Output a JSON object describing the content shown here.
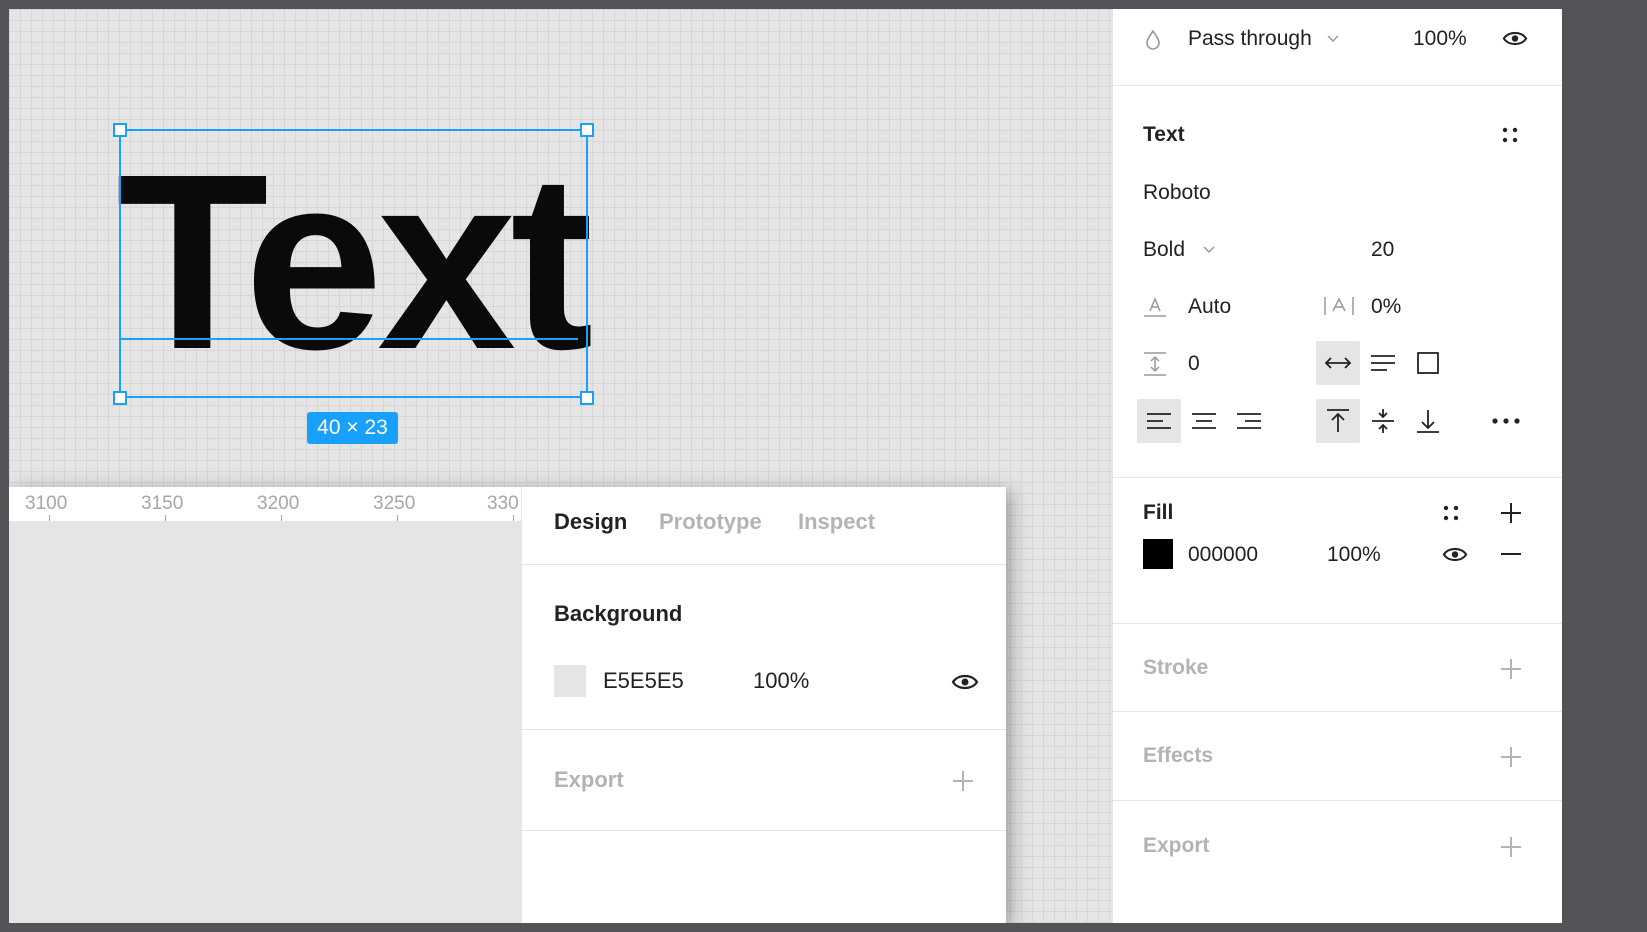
{
  "canvas": {
    "text_layer": "Text",
    "size_badge": "40 × 23"
  },
  "overlay": {
    "ruler": [
      "3100",
      "3150",
      "3200",
      "3250",
      "330"
    ],
    "tabs": [
      {
        "label": "Design",
        "active": true
      },
      {
        "label": "Prototype",
        "active": false
      },
      {
        "label": "Inspect",
        "active": false
      }
    ],
    "background": {
      "title": "Background",
      "color": "E5E5E5",
      "opacity": "100%"
    },
    "export_title": "Export"
  },
  "right_panel": {
    "layer": {
      "blend_mode": "Pass through",
      "opacity": "100%"
    },
    "text": {
      "title": "Text",
      "font_family": "Roboto",
      "font_weight": "Bold",
      "font_size": "20",
      "line_height": "Auto",
      "letter_spacing": "0%",
      "paragraph_spacing": "0"
    },
    "fill": {
      "title": "Fill",
      "color": "000000",
      "opacity": "100%"
    },
    "stroke_title": "Stroke",
    "effects_title": "Effects",
    "export_title": "Export"
  },
  "colors": {
    "accent": "#18a0fb",
    "canvas": "#e5e5e5",
    "fill": "#000000"
  }
}
